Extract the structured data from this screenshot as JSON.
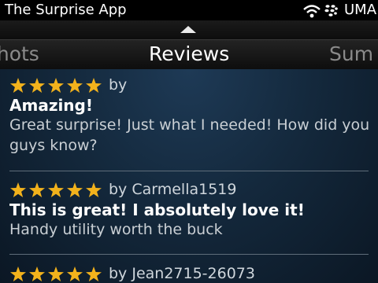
{
  "status_bar": {
    "app_title": "The Surprise App",
    "network_label": "UMA"
  },
  "tabs": [
    {
      "label": "Screenshots",
      "visible_text": "nshots",
      "selected": false
    },
    {
      "label": "Reviews",
      "visible_text": "Reviews",
      "selected": true
    },
    {
      "label": "Summary",
      "visible_text": "Sum",
      "selected": false
    }
  ],
  "reviews": [
    {
      "rating": 5,
      "byline": "by",
      "title": "Amazing!",
      "body": "Great surprise! Just what I needed! How did you guys know?"
    },
    {
      "rating": 5,
      "byline": "by Carmella1519",
      "title": "This is great! I absolutely love it!",
      "body": "Handy utility worth the buck"
    },
    {
      "rating": 5,
      "byline": "by Jean2715-26073",
      "title": "",
      "body": ""
    }
  ],
  "colors": {
    "star": "#f2b21c",
    "background": "#14293d",
    "status_bar": "#000000"
  },
  "icons": {
    "signal": "wifi-signal-icon",
    "carrier": "blackberry-logo-icon",
    "scroll_up": "up-arrow-icon",
    "rating": "star-icon"
  }
}
